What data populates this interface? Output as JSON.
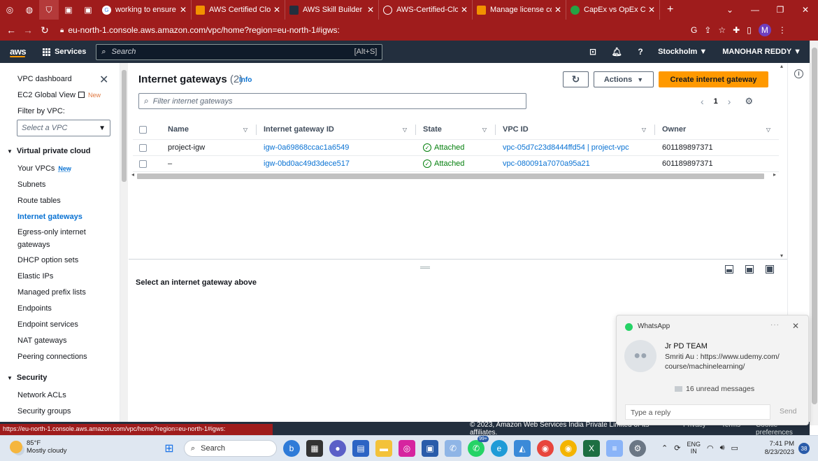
{
  "browser": {
    "tabs": [
      {
        "title": "working to ensure co",
        "icon_color": "#ffffff"
      },
      {
        "title": "AWS Certified Cloud P",
        "icon_color": "#f29100"
      },
      {
        "title": "AWS Skill Builder",
        "icon_color": "#232f3e"
      },
      {
        "title": "AWS-Certified-Cloud",
        "icon_color": "#ffffff"
      },
      {
        "title": "Manage license comp",
        "icon_color": "#f29100"
      },
      {
        "title": "CapEx vs OpEx Cloud",
        "icon_color": "#25a244"
      }
    ],
    "new_tab": "+",
    "url": "eu-north-1.console.aws.amazon.com/vpc/home?region=eu-north-1#igws:",
    "profile_initial": "M",
    "status_url": "https://eu-north-1.console.aws.amazon.com/vpc/home?region=eu-north-1#igws:",
    "theme_color": "#9f1c1c"
  },
  "awsnav": {
    "logo": "aws",
    "services": "Services",
    "search_placeholder": "Search",
    "search_shortcut": "[Alt+S]",
    "region": "Stockholm ▼",
    "user": "MANOHAR REDDY ▼"
  },
  "sidebar": {
    "dashboard": "VPC dashboard",
    "ec2_global_view": "EC2 Global View",
    "new_label": "New",
    "filter_label": "Filter by VPC:",
    "filter_placeholder": "Select a VPC",
    "section_vpc": "Virtual private cloud",
    "items": [
      {
        "label": "Your VPCs",
        "badge": "New"
      },
      {
        "label": "Subnets"
      },
      {
        "label": "Route tables"
      },
      {
        "label": "Internet gateways"
      },
      {
        "label": "Egress-only internet"
      },
      {
        "label": "gateways"
      },
      {
        "label": "DHCP option sets"
      },
      {
        "label": "Elastic IPs"
      },
      {
        "label": "Managed prefix lists"
      },
      {
        "label": "Endpoints"
      },
      {
        "label": "Endpoint services"
      },
      {
        "label": "NAT gateways"
      },
      {
        "label": "Peering connections"
      }
    ],
    "section_security": "Security",
    "security_items": [
      {
        "label": "Network ACLs"
      },
      {
        "label": "Security groups"
      }
    ]
  },
  "main": {
    "title": "Internet gateways",
    "count": "(2)",
    "info": "Info",
    "actions_label": "Actions",
    "create_label": "Create internet gateway",
    "filter_placeholder": "Filter internet gateways",
    "page_number": "1",
    "columns": [
      "Name",
      "Internet gateway ID",
      "State",
      "VPC ID",
      "Owner"
    ],
    "rows": [
      {
        "name": "project-igw",
        "igw_id": "igw-0a69868ccac1a6549",
        "state": "Attached",
        "vpc_id": "vpc-05d7c23d8444ffd54 | project-vpc",
        "owner": "601189897371"
      },
      {
        "name": "–",
        "igw_id": "igw-0bd0ac49d3dece517",
        "state": "Attached",
        "vpc_id": "vpc-080091a7070a95a21",
        "owner": "601189897371"
      }
    ],
    "details_message": "Select an internet gateway above"
  },
  "footer": {
    "copyright": "© 2023, Amazon Web Services India Private Limited or its affiliates.",
    "privacy": "Privacy",
    "terms": "Terms",
    "cookies": "Cookie preferences"
  },
  "whatsapp": {
    "app": "WhatsApp",
    "more": "···",
    "sender": "Jr PD TEAM",
    "message": "Smriti Au : https://www.udemy.com/ course/machinelearning/",
    "unread": "16 unread messages",
    "reply_placeholder": "Type a reply",
    "send": "Send"
  },
  "taskbar": {
    "temperature": "85°F",
    "weather": "Mostly cloudy",
    "search": "Search",
    "badge": "99+",
    "lang_top": "ENG",
    "lang_bottom": "IN",
    "time": "7:41 PM",
    "date": "8/23/2023",
    "notifications": "38"
  }
}
